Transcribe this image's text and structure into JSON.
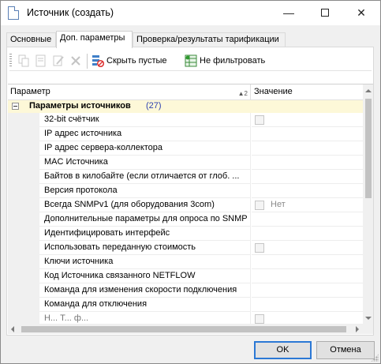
{
  "window": {
    "title": "Источник (создать)",
    "minimize_glyph": "—",
    "close_glyph": "✕"
  },
  "tabs": [
    {
      "label": "Основные",
      "active": false
    },
    {
      "label": "Доп. параметры",
      "active": true
    },
    {
      "label": "Проверка/результаты тарификации",
      "active": false
    }
  ],
  "toolbar": {
    "icons": [
      "copy-icon",
      "edit-icon",
      "pencil-icon",
      "delete-icon"
    ],
    "hide_empty_label": "Скрыть пустые",
    "no_filter_label": "Не фильтровать"
  },
  "grid": {
    "col_param": "Параметр",
    "col_value": "Значение",
    "sort_mark": "▲2",
    "group": {
      "label": "Параметры источников",
      "count": "(27)"
    },
    "rows": [
      {
        "name": "32-bit счётчик",
        "value_type": "checkbox",
        "value": ""
      },
      {
        "name": "IP адрес источника",
        "value_type": "text",
        "value": ""
      },
      {
        "name": "IP адрес сервера-коллектора",
        "value_type": "text",
        "value": ""
      },
      {
        "name": "MAC Источника",
        "value_type": "text",
        "value": ""
      },
      {
        "name": "Байтов в килобайте (если отличается от глоб. ...",
        "value_type": "text",
        "value": ""
      },
      {
        "name": "Версия протокола",
        "value_type": "text",
        "value": ""
      },
      {
        "name": "Всегда SNMPv1 (для оборудования 3com)",
        "value_type": "checkbox",
        "value": "Нет"
      },
      {
        "name": "Дополнительные параметры для опроса по SNMP",
        "value_type": "text",
        "value": ""
      },
      {
        "name": "Идентифицировать интерфейс",
        "value_type": "text",
        "value": ""
      },
      {
        "name": "Использовать переданную стоимость",
        "value_type": "checkbox",
        "value": ""
      },
      {
        "name": "Ключи источника",
        "value_type": "text",
        "value": ""
      },
      {
        "name": "Код Источника связанного NETFLOW",
        "value_type": "text",
        "value": ""
      },
      {
        "name": "Команда для изменения скорости подключения",
        "value_type": "text",
        "value": ""
      },
      {
        "name": "Команда для отключения",
        "value_type": "text",
        "value": ""
      },
      {
        "name": "Н... Т... ф...",
        "value_type": "checkbox",
        "value": ""
      }
    ]
  },
  "buttons": {
    "ok": "OK",
    "cancel": "Отмена"
  }
}
